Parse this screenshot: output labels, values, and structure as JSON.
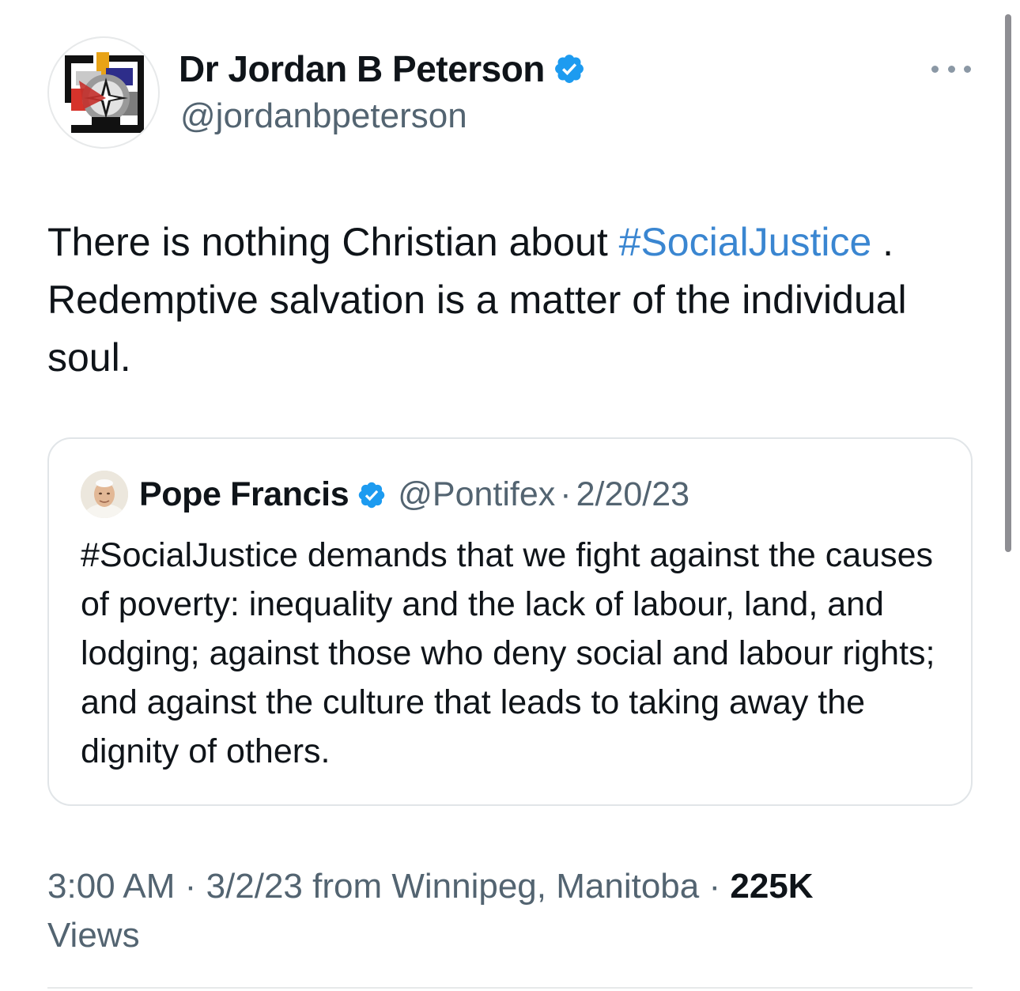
{
  "tweet": {
    "author": {
      "display_name": "Dr Jordan B Peterson",
      "handle": "@jordanbpeterson",
      "verified": true,
      "avatar_icon": "geometric-logo-icon"
    },
    "more_icon": "more-options-icon",
    "text_part1": "There is nothing Christian about ",
    "hashtag": "#SocialJustice",
    "text_part2": " . Redemptive salvation is a matter of the individual soul.",
    "quoted": {
      "display_name": "Pope Francis",
      "handle": "@Pontifex",
      "separator": "·",
      "date": "2/20/23",
      "verified": true,
      "hashtag": "#SocialJustice",
      "text": " demands that we fight against the causes of poverty: inequality and the lack of labour, land, and lodging; against those who deny social and labour rights; and against the culture that leads to taking away the dignity of others."
    },
    "meta": {
      "time": "3:00 AM",
      "separator": "·",
      "date_location": "3/2/23 from Winnipeg, Manitoba",
      "views_count": "225K",
      "views_label": "Views"
    }
  },
  "colors": {
    "verified_badge": "#1d9bf0",
    "hashtag": "#1d9bf0",
    "secondary_text": "#536471"
  }
}
